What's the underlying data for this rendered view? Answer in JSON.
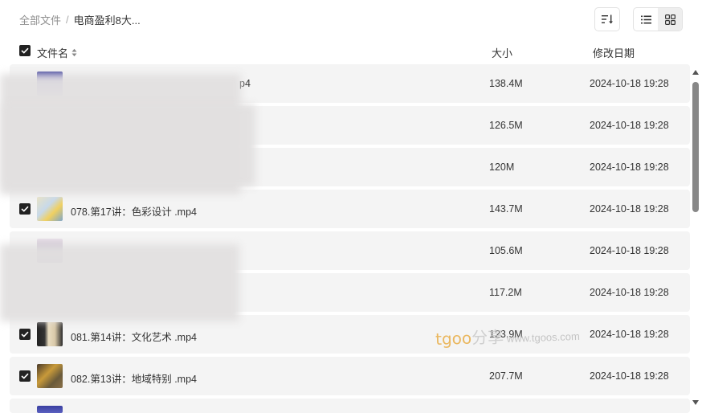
{
  "breadcrumb": {
    "root": "全部文件",
    "separator": "/",
    "current": "电商盈利8大..."
  },
  "toolbar": {
    "sort_icon": "sort-icon",
    "list_icon": "list-view-icon",
    "grid_icon": "grid-view-icon",
    "active_view": "grid"
  },
  "table": {
    "headers": {
      "name": "文件名",
      "size": "大小",
      "date": "修改日期"
    },
    "rows": [
      {
        "name": "p4",
        "size": "138.4M",
        "date": "2024-10-18 19:28"
      },
      {
        "name": "",
        "size": "126.5M",
        "date": "2024-10-18 19:28"
      },
      {
        "name": "",
        "size": "120M",
        "date": "2024-10-18 19:28"
      },
      {
        "name": "078.第17讲：色彩设计 .mp4",
        "size": "143.7M",
        "date": "2024-10-18 19:28"
      },
      {
        "name": "",
        "size": "105.6M",
        "date": "2024-10-18 19:28"
      },
      {
        "name": "",
        "size": "117.2M",
        "date": "2024-10-18 19:28"
      },
      {
        "name": "081.第14讲：文化艺术 .mp4",
        "size": "123.9M",
        "date": "2024-10-18 19:28"
      },
      {
        "name": "082.第13讲：地域特别 .mp4",
        "size": "207.7M",
        "date": "2024-10-18 19:28"
      },
      {
        "name": "",
        "size": "",
        "date": ""
      }
    ]
  },
  "watermark": {
    "brand": "tgoo",
    "cn": "分享",
    "url": "www.tgoos.com"
  },
  "colors": {
    "row_bg": "#f4f4f4",
    "checkbox": "#222222",
    "watermark_brand": "#e8a93a"
  }
}
